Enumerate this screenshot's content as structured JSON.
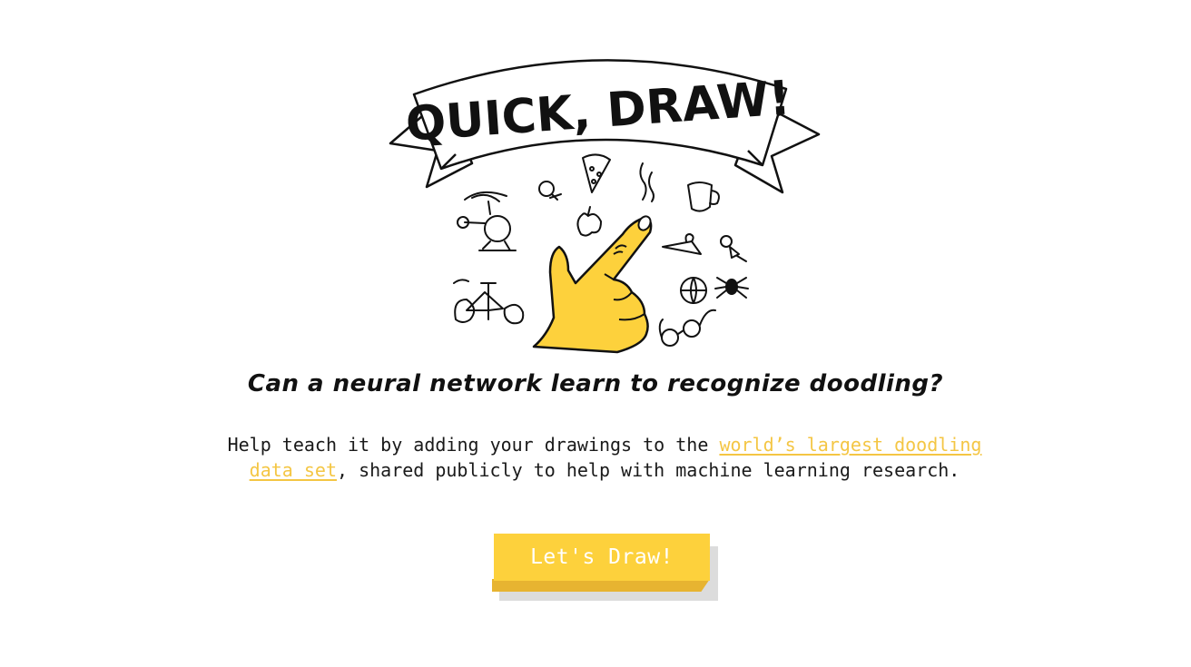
{
  "logo": {
    "text": "QUICK, DRAW!"
  },
  "tagline": "Can a neural network learn to recognize doodling?",
  "description": {
    "before_link": "Help teach it by adding your drawings to the ",
    "link_text": "world’s largest doodling data set",
    "after_link": ", shared publicly to help with machine learning research."
  },
  "cta": {
    "label": "Let's Draw!"
  },
  "colors": {
    "accent_yellow": "#fdd13c",
    "button_edge": "#e7b431",
    "link": "#f4c644",
    "text": "#1a1a1a"
  },
  "doodle_icons": [
    "helicopter-icon",
    "lightbulb-icon",
    "pizza-icon",
    "apple-icon",
    "steam-icon",
    "mug-icon",
    "hanger-icon",
    "pushpin-icon",
    "bicycle-icon",
    "basketball-icon",
    "spider-icon",
    "eyeglasses-icon",
    "pointing-hand-icon"
  ]
}
